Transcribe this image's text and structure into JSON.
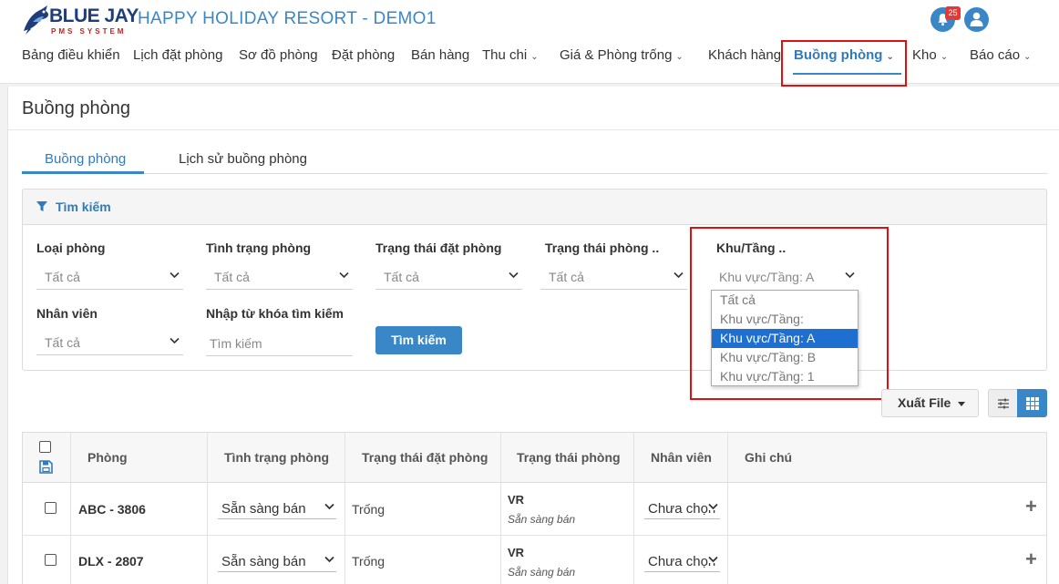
{
  "brand": {
    "name": "BLUE JAY",
    "subtitle": "PMS SYSTEM"
  },
  "header": {
    "title": "HAPPY HOLIDAY RESORT - DEMO1",
    "notification_count": "25"
  },
  "nav": {
    "items": [
      {
        "label": "Bảng điều khiển"
      },
      {
        "label": "Lịch đặt phòng"
      },
      {
        "label": "Sơ đồ phòng"
      },
      {
        "label": "Đặt phòng"
      },
      {
        "label": "Bán hàng"
      },
      {
        "label": "Thu chi"
      },
      {
        "label": "Giá & Phòng trống"
      },
      {
        "label": "Khách hàng"
      },
      {
        "label": "Buồng phòng",
        "active": true
      },
      {
        "label": "Kho"
      },
      {
        "label": "Báo cáo"
      }
    ]
  },
  "page": {
    "title": "Buồng phòng"
  },
  "tabs": [
    {
      "label": "Buồng phòng",
      "active": true
    },
    {
      "label": "Lịch sử buồng phòng"
    }
  ],
  "search": {
    "header": "Tìm kiếm",
    "fields": {
      "room_type": {
        "label": "Loại phòng",
        "value": "Tất cả"
      },
      "room_condition": {
        "label": "Tình trạng phòng",
        "value": "Tất cả"
      },
      "booking_status": {
        "label": "Trạng thái đặt phòng",
        "value": "Tất cả"
      },
      "room_status": {
        "label": "Trạng thái phòng ..",
        "value": "Tất cả"
      },
      "area_floor": {
        "label": "Khu/Tầng ..",
        "value": "Khu vực/Tầng: A"
      },
      "staff": {
        "label": "Nhân viên",
        "value": "Tất cả"
      },
      "keyword": {
        "label": "Nhập từ khóa tìm kiếm",
        "placeholder": "Tìm kiếm"
      }
    },
    "button": "Tìm kiếm",
    "area_options": [
      {
        "label": "Tất cả"
      },
      {
        "label": "Khu vực/Tầng:"
      },
      {
        "label": "Khu vực/Tầng: A",
        "selected": true
      },
      {
        "label": "Khu vực/Tầng: B"
      },
      {
        "label": "Khu vực/Tầng: 1"
      }
    ]
  },
  "toolbar": {
    "export_label": "Xuất File"
  },
  "table": {
    "headers": [
      "Phòng",
      "Tình trạng phòng",
      "Trạng thái đặt phòng",
      "Trạng thái phòng",
      "Nhân viên",
      "Ghi chú"
    ],
    "rows": [
      {
        "room": "ABC - 3806",
        "condition": "Sẵn sàng bán",
        "booking": "Trống",
        "status_code": "VR",
        "status_text": "Sẵn sàng bán",
        "staff": "Chưa chọn",
        "note": ""
      },
      {
        "room": "DLX - 2807",
        "condition": "Sẵn sàng bán",
        "booking": "Trống",
        "status_code": "VR",
        "status_text": "Sẵn sàng bán",
        "staff": "Chưa chọn",
        "note": ""
      }
    ]
  },
  "colors": {
    "primary": "#3a87c8",
    "highlight": "#e01010",
    "selected_option": "#1e6fd0",
    "badge": "#e53935"
  }
}
